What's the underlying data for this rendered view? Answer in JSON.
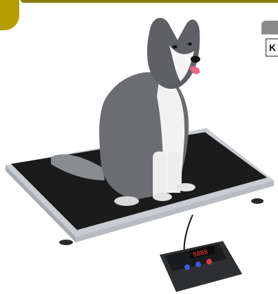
{
  "side_box": {
    "text": "K"
  },
  "display": {
    "digits": "8888"
  }
}
